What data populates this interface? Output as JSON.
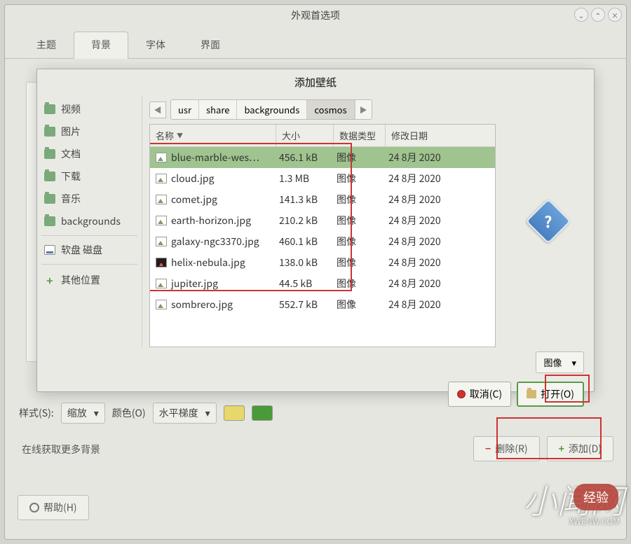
{
  "window": {
    "title": "外观首选项",
    "controls": {
      "min": "⌄",
      "max": "⌃",
      "close": "×"
    }
  },
  "tabs": [
    "主题",
    "背景",
    "字体",
    "界面"
  ],
  "active_tab_index": 1,
  "dialog": {
    "title": "添加壁纸",
    "breadcrumb": [
      "usr",
      "share",
      "backgrounds",
      "cosmos"
    ],
    "breadcrumb_active_index": 3,
    "places": [
      {
        "icon": "folder",
        "label": "视频"
      },
      {
        "icon": "folder",
        "label": "图片"
      },
      {
        "icon": "folder",
        "label": "文档"
      },
      {
        "icon": "folder",
        "label": "下载"
      },
      {
        "icon": "folder",
        "label": "音乐"
      },
      {
        "icon": "folder",
        "label": "backgrounds"
      },
      {
        "icon": "disk",
        "label": "软盘 磁盘"
      },
      {
        "icon": "plus",
        "label": "其他位置"
      }
    ],
    "columns": {
      "name": "名称",
      "size": "大小",
      "type": "数据类型",
      "date": "修改日期"
    },
    "files": [
      {
        "name": "blue-marble-wes…",
        "size": "456.1 kB",
        "type": "图像",
        "date": "24 8月 2020",
        "selected": true,
        "icon": "img"
      },
      {
        "name": "cloud.jpg",
        "size": "1.3 MB",
        "type": "图像",
        "date": "24 8月 2020",
        "selected": false,
        "icon": "img"
      },
      {
        "name": "comet.jpg",
        "size": "141.3 kB",
        "type": "图像",
        "date": "24 8月 2020",
        "selected": false,
        "icon": "img"
      },
      {
        "name": "earth-horizon.jpg",
        "size": "210.2 kB",
        "type": "图像",
        "date": "24 8月 2020",
        "selected": false,
        "icon": "img"
      },
      {
        "name": "galaxy-ngc3370.jpg",
        "size": "460.1 kB",
        "type": "图像",
        "date": "24 8月 2020",
        "selected": false,
        "icon": "img"
      },
      {
        "name": "helix-nebula.jpg",
        "size": "138.0 kB",
        "type": "图像",
        "date": "24 8月 2020",
        "selected": false,
        "icon": "dark"
      },
      {
        "name": "jupiter.jpg",
        "size": "44.5 kB",
        "type": "图像",
        "date": "24 8月 2020",
        "selected": false,
        "icon": "img"
      },
      {
        "name": "sombrero.jpg",
        "size": "552.7 kB",
        "type": "图像",
        "date": "24 8月 2020",
        "selected": false,
        "icon": "img"
      }
    ],
    "filter": "图像",
    "cancel": "取消(C)",
    "open": "打开(O)"
  },
  "bottom": {
    "style_label": "样式(S):",
    "style_value": "缩放",
    "color_label": "颜色(O)",
    "gradient_value": "水平梯度"
  },
  "more_link": "在线获取更多背景",
  "main_actions": {
    "remove": "删除(R)",
    "add": "添加(D)"
  },
  "help_button": "帮助(H)",
  "watermark": {
    "big": "小闻网",
    "url": "XWENW.COM",
    "badge": "经验"
  }
}
